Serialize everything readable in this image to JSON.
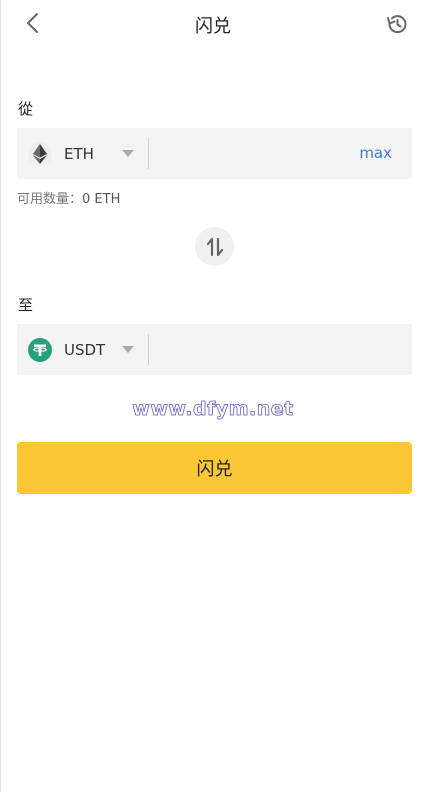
{
  "header": {
    "title": "闪兑",
    "back_icon": "chevron-left-icon",
    "history_icon": "history-icon"
  },
  "from": {
    "label": "從",
    "token": "ETH",
    "token_icon": "ethereum-icon",
    "amount_value": "",
    "max_label": "max",
    "available_label": "可用数量：",
    "available_amount": "0 ETH"
  },
  "swap": {
    "icon": "swap-vertical-icon"
  },
  "to": {
    "label": "至",
    "token": "USDT",
    "token_icon": "tether-icon",
    "amount_value": ""
  },
  "watermark": "www.dfym.net",
  "submit": {
    "label": "闪兑"
  },
  "colors": {
    "accent": "#fcc737",
    "link": "#3b7bd6",
    "usdt": "#26a17b",
    "field_bg": "#f4f4f4"
  }
}
